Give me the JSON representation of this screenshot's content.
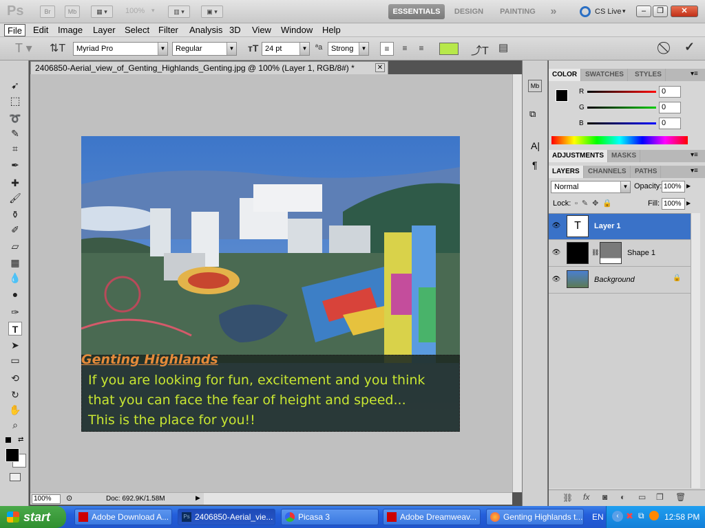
{
  "app": {
    "logo": "Ps",
    "zoom": "100%"
  },
  "appbar": {
    "bridge_label": "Br",
    "minibridge_label": "Mb",
    "workspaces": [
      "ESSENTIALS",
      "DESIGN",
      "PAINTING"
    ],
    "more": "»",
    "cslive": "CS Live"
  },
  "menu": [
    "File",
    "Edit",
    "Image",
    "Layer",
    "Select",
    "Filter",
    "Analysis",
    "3D",
    "View",
    "Window",
    "Help"
  ],
  "options": {
    "font_family": "Myriad Pro",
    "font_style": "Regular",
    "font_size": "24 pt",
    "antialias": "Strong",
    "text_color": "#b7e84a"
  },
  "document": {
    "tab_title": "2406850-Aerial_view_of_Genting_Highlands_Genting.jpg @ 100% (Layer 1, RGB/8#) *",
    "zoom": "100%",
    "doc_info": "Doc: 692.9K/1.58M"
  },
  "image_text": {
    "heading": "Genting Highlands",
    "line1": "If you are looking for fun, excitement and you think",
    "line2": "that you can face the fear of height and speed...",
    "line3": "This is the place for you!!"
  },
  "color_panel": {
    "tabs": [
      "COLOR",
      "SWATCHES",
      "STYLES"
    ],
    "r_label": "R",
    "g_label": "G",
    "b_label": "B",
    "r": "0",
    "g": "0",
    "b": "0"
  },
  "adjustments_panel": {
    "tabs": [
      "ADJUSTMENTS",
      "MASKS"
    ]
  },
  "layers_panel": {
    "tabs": [
      "LAYERS",
      "CHANNELS",
      "PATHS"
    ],
    "blend_mode": "Normal",
    "opacity_label": "Opacity:",
    "opacity": "100%",
    "lock_label": "Lock:",
    "fill_label": "Fill:",
    "fill": "100%",
    "layers": [
      {
        "name": "Layer 1",
        "selected": true
      },
      {
        "name": "Shape 1",
        "selected": false
      },
      {
        "name": "Background",
        "selected": false
      }
    ]
  },
  "taskbar": {
    "start": "start",
    "items": [
      {
        "label": "Adobe Download A...",
        "active": false
      },
      {
        "label": "2406850-Aerial_vie...",
        "active": true
      },
      {
        "label": "Picasa 3",
        "active": false
      },
      {
        "label": "Adobe Dreamweav...",
        "active": false
      },
      {
        "label": "Genting Highlands t...",
        "active": false
      }
    ],
    "language": "EN",
    "time": "12:58 PM"
  }
}
